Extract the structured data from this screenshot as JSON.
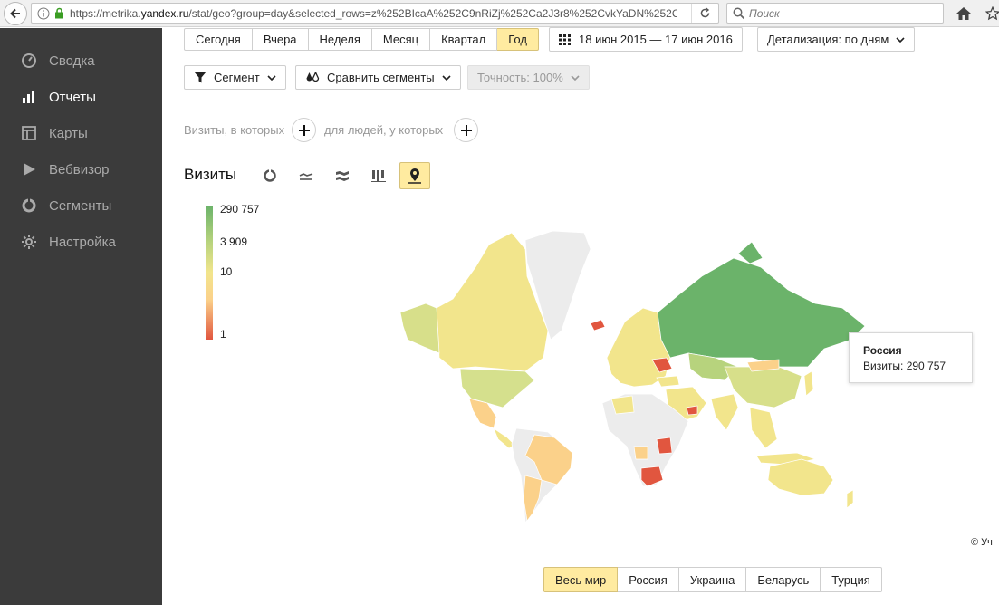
{
  "browser": {
    "url_prefix": "https://metrika.",
    "url_domain": "yandex.ru",
    "url_rest": "/stat/geo?group=day&selected_rows=z%252BIcaA%252C9nRiZj%252Ca2J3r8%252CvkYaDN%252C",
    "search_placeholder": "Поиск"
  },
  "sidebar": {
    "items": [
      {
        "label": "Сводка",
        "icon": "gauge-icon"
      },
      {
        "label": "Отчеты",
        "icon": "bar-chart-icon"
      },
      {
        "label": "Карты",
        "icon": "layout-icon"
      },
      {
        "label": "Вебвизор",
        "icon": "play-icon"
      },
      {
        "label": "Сегменты",
        "icon": "pie-icon"
      },
      {
        "label": "Настройка",
        "icon": "gear-icon"
      }
    ],
    "active": "Отчеты"
  },
  "periods": {
    "items": [
      "Сегодня",
      "Вчера",
      "Неделя",
      "Месяц",
      "Квартал",
      "Год"
    ],
    "selected": "Год"
  },
  "date_range": "18 июн 2015 — 17 июн 2016",
  "detail": "Детализация: по дням",
  "segment_btn": "Сегмент",
  "compare_btn": "Сравнить сегменты",
  "accuracy_btn": "Точность: 100%",
  "conditions": {
    "visits_where": "Визиты, в которых",
    "for_people": "для людей, у которых"
  },
  "report_title": "Визиты",
  "legend": {
    "max": "290 757",
    "mid": "3 909",
    "low": "10",
    "min": "1"
  },
  "tooltip": {
    "country": "Россия",
    "value_label": "Визиты: 290 757"
  },
  "copyright": "© Уч",
  "regions": {
    "items": [
      "Весь мир",
      "Россия",
      "Украина",
      "Беларусь",
      "Турция"
    ],
    "selected": "Весь мир"
  },
  "colors": {
    "green_high": "#6bb36a",
    "green_mid": "#b7d37d",
    "yellow": "#f2e58c",
    "orange": "#fbd18a",
    "red": "#e1563f",
    "nodata": "#ececec",
    "accent_selected": "#ffeba0"
  }
}
